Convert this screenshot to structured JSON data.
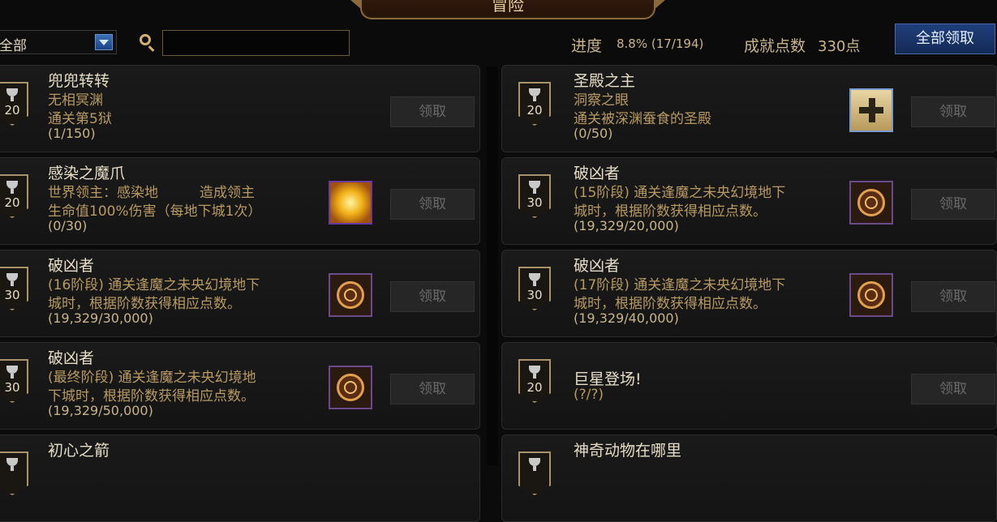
{
  "header": {
    "title": "冒险",
    "filter_value": "全部",
    "search_placeholder": "",
    "progress_label": "进度",
    "progress_value": "8.8% (17/194)",
    "points_label": "成就点数",
    "points_value": "330点",
    "claim_all_label": "全部领取"
  },
  "claim_label": "领取",
  "left": [
    {
      "points": "20",
      "title": "兜兜转转",
      "sub": "无相冥渊",
      "desc": "通关第5狱",
      "progress": "(1/150)"
    },
    {
      "points": "20",
      "title": "感染之魔爪",
      "sub": "世界领主：感染地　　　造成领主",
      "desc": "生命值100%伤害（每地下城1次）",
      "progress": "(0/30)",
      "reward": "gold-star-icon"
    },
    {
      "points": "30",
      "title": "破凶者",
      "sub": "(16阶段) 通关逢魔之未央幻境地下",
      "desc": "城时，根据阶数获得相应点数。",
      "progress": "(19,329/30,000)",
      "reward": "emblem-icon"
    },
    {
      "points": "30",
      "title": "破凶者",
      "sub": "(最终阶段) 通关逢魔之未央幻境地",
      "desc": "下城时，根据阶数获得相应点数。",
      "progress": "(19,329/50,000)",
      "reward": "emblem-icon"
    }
  ],
  "right": [
    {
      "points": "20",
      "title": "圣殿之主",
      "sub": "洞察之眼",
      "desc": "通关被深渊蚕食的圣殿",
      "progress": "(0/50)",
      "reward": "cross-icon"
    },
    {
      "points": "30",
      "title": "破凶者",
      "sub": "(15阶段) 通关逢魔之未央幻境地下",
      "desc": "城时，根据阶数获得相应点数。",
      "progress": "(19,329/20,000)",
      "reward": "emblem-icon"
    },
    {
      "points": "30",
      "title": "破凶者",
      "sub": "(17阶段) 通关逢魔之未央幻境地下",
      "desc": "城时，根据阶数获得相应点数。",
      "progress": "(19,329/40,000)",
      "reward": "emblem-icon"
    },
    {
      "points": "20",
      "title": "巨星登场!",
      "sub": "(?/?)",
      "desc": "",
      "progress": ""
    }
  ],
  "partial": {
    "left_title": "初心之箭",
    "right_title": "神奇动物在哪里"
  }
}
